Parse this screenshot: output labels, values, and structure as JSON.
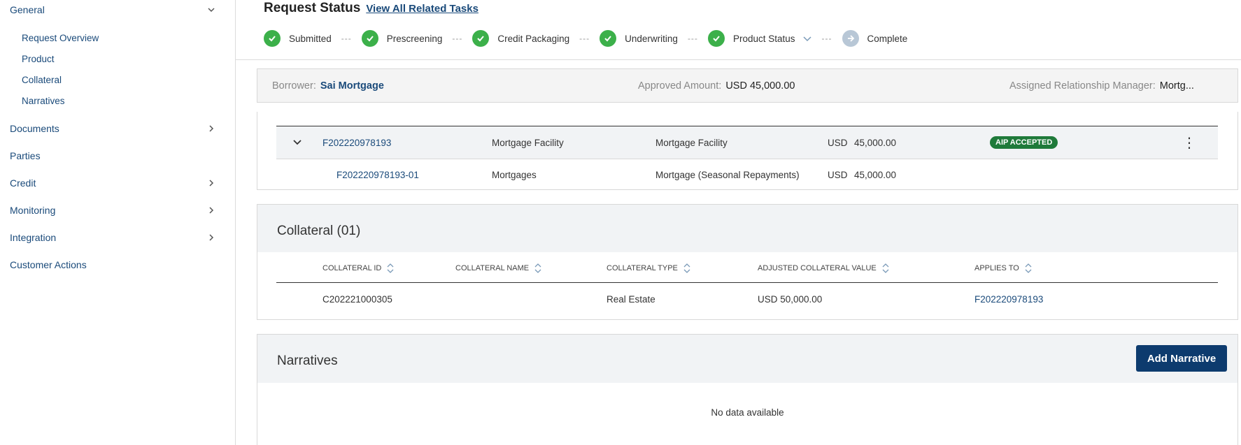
{
  "sidebar": {
    "general": "General",
    "general_items": [
      "Request Overview",
      "Product",
      "Collateral",
      "Narratives"
    ],
    "documents": "Documents",
    "parties": "Parties",
    "credit": "Credit",
    "monitoring": "Monitoring",
    "integration": "Integration",
    "customer_actions": "Customer Actions"
  },
  "request_status": {
    "title": "Request Status",
    "link": "View All Related Tasks",
    "steps": [
      {
        "label": "Submitted",
        "state": "done"
      },
      {
        "label": "Prescreening",
        "state": "done"
      },
      {
        "label": "Credit Packaging",
        "state": "done"
      },
      {
        "label": "Underwriting",
        "state": "done"
      },
      {
        "label": "Product Status",
        "state": "done"
      },
      {
        "label": "Complete",
        "state": "pending"
      }
    ],
    "separator": "---"
  },
  "summary": {
    "borrower_label": "Borrower:",
    "borrower_value": "Sai Mortgage",
    "approved_label": "Approved Amount:",
    "approved_value": "USD 45,000.00",
    "rm_label": "Assigned Relationship Manager:",
    "rm_value": "Mortg..."
  },
  "facility": {
    "parent": {
      "id": "F202220978193",
      "type": "Mortgage Facility",
      "product": "Mortgage Facility",
      "currency": "USD",
      "amount": "45,000.00",
      "status": "AIP ACCEPTED"
    },
    "child": {
      "id": "F202220978193-01",
      "type": "Mortgages",
      "product": "Mortgage (Seasonal Repayments)",
      "currency": "USD",
      "amount": "45,000.00"
    }
  },
  "collateral": {
    "title": "Collateral (01)",
    "columns": [
      "COLLATERAL ID",
      "COLLATERAL NAME",
      "COLLATERAL TYPE",
      "ADJUSTED COLLATERAL VALUE",
      "APPLIES TO"
    ],
    "row": {
      "id": "C202221000305",
      "name": "",
      "type": "Real Estate",
      "value": "USD 50,000.00",
      "applies_to": "F202220978193"
    }
  },
  "narratives": {
    "title": "Narratives",
    "add_button": "Add Narrative",
    "empty": "No data available"
  },
  "colors": {
    "accent": "#1a4a7a",
    "success": "#3cb04a",
    "badge": "#1f7a3a",
    "primary_button": "#0d3b6e"
  }
}
